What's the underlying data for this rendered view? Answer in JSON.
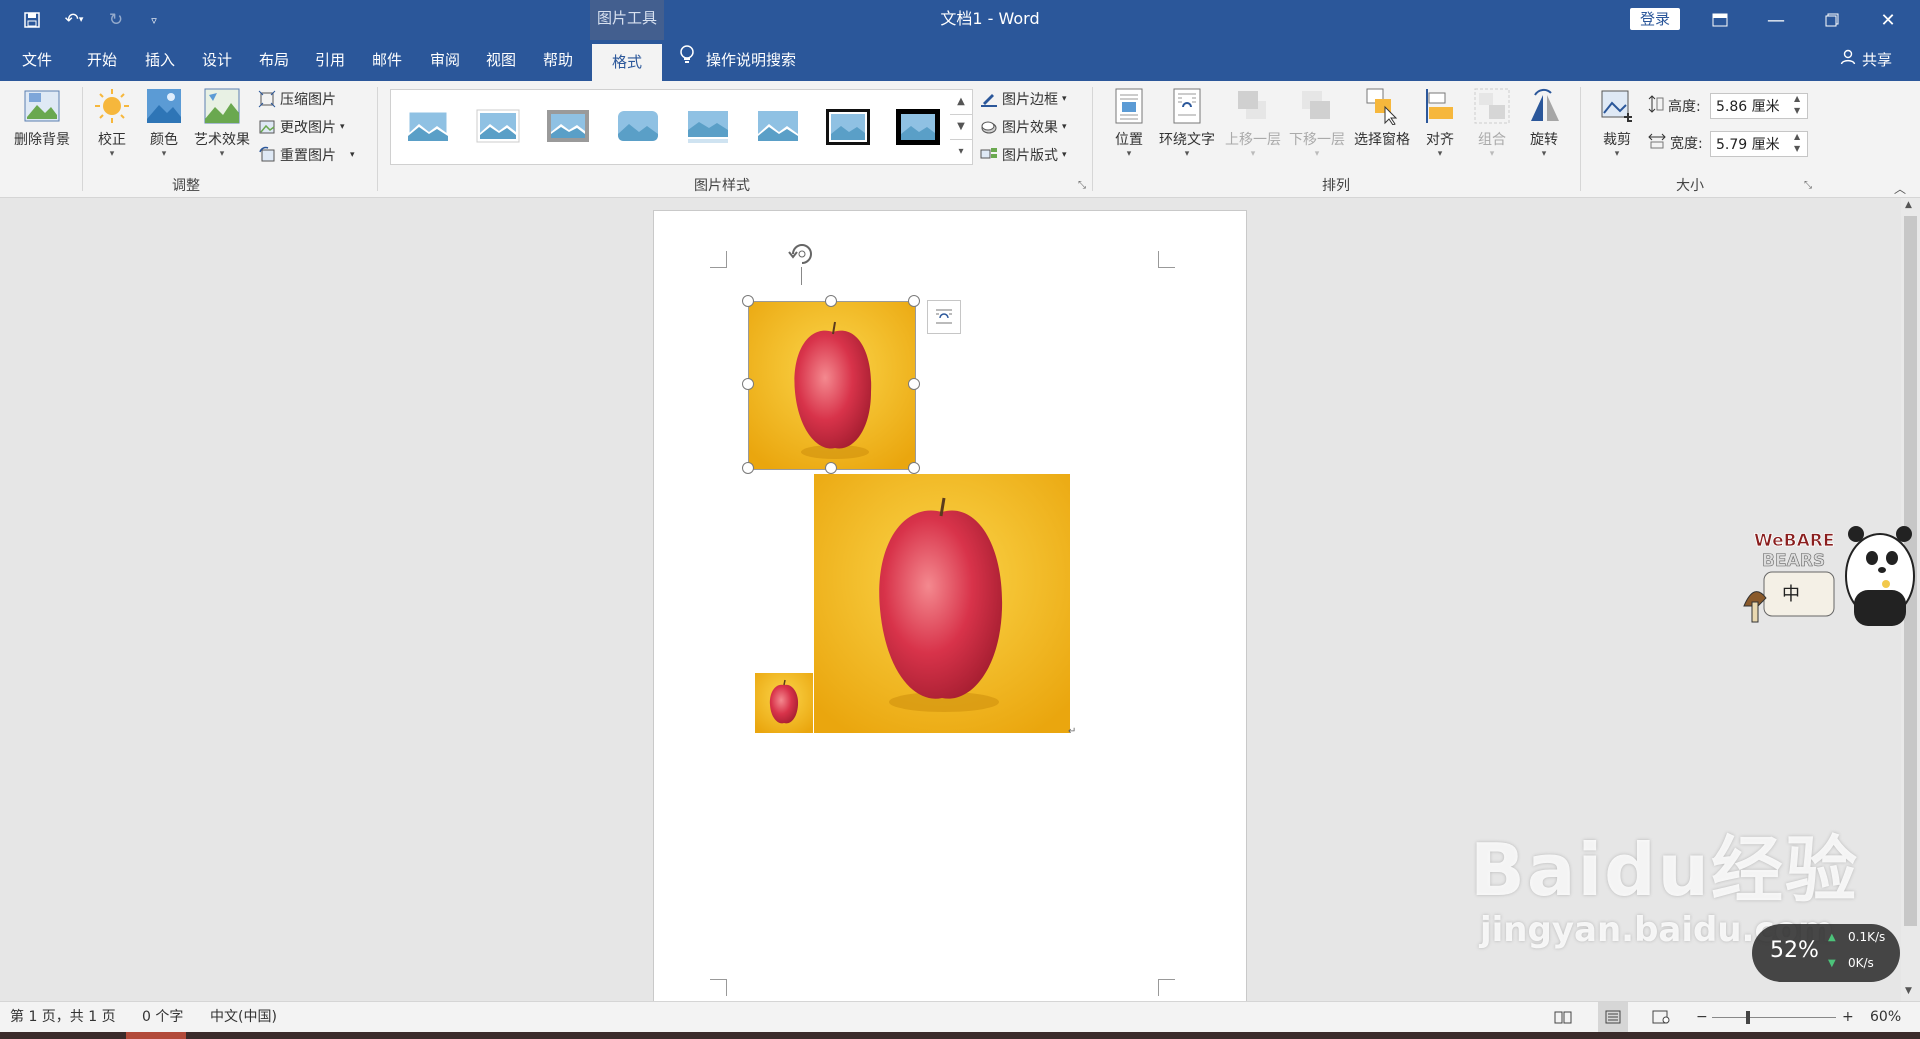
{
  "titlebar": {
    "context_label": "图片工具",
    "doc_title": "文档1  -  Word",
    "login_label": "登录"
  },
  "tabs": [
    "文件",
    "开始",
    "插入",
    "设计",
    "布局",
    "引用",
    "邮件",
    "审阅",
    "视图",
    "帮助",
    "格式"
  ],
  "active_tab": "格式",
  "search_label": "操作说明搜索",
  "share_label": "共享",
  "ribbon": {
    "adjust": {
      "remove_bg": "删除背景",
      "correct": "校正",
      "color": "颜色",
      "artistic": "艺术效果",
      "compress": "压缩图片",
      "change": "更改图片",
      "reset": "重置图片",
      "label": "调整"
    },
    "styles": {
      "border": "图片边框",
      "effects": "图片效果",
      "layout": "图片版式",
      "label": "图片样式"
    },
    "arrange": {
      "position": "位置",
      "wrap": "环绕文字",
      "forward": "上移一层",
      "backward": "下移一层",
      "pane": "选择窗格",
      "align": "对齐",
      "group": "组合",
      "rotate": "旋转",
      "label": "排列"
    },
    "size": {
      "crop": "裁剪",
      "height_label": "高度:",
      "height_value": "5.86 厘米",
      "width_label": "宽度:",
      "width_value": "5.79 厘米",
      "label": "大小"
    }
  },
  "status": {
    "page": "第 1 页，共 1 页",
    "words": "0 个字",
    "lang": "中文(中国)",
    "zoom": "60%"
  },
  "overlay": {
    "sticker_text": "中",
    "cpu_percent": "52%",
    "net_up": "0.1K/s",
    "net_down": "0K/s",
    "watermark": "Baidu经验",
    "watermark_url": "jingyan.baidu.com"
  },
  "colors": {
    "brand": "#2b579a",
    "ribbon_bg": "#f3f3f3",
    "apple_bg": "#f2b51c"
  }
}
